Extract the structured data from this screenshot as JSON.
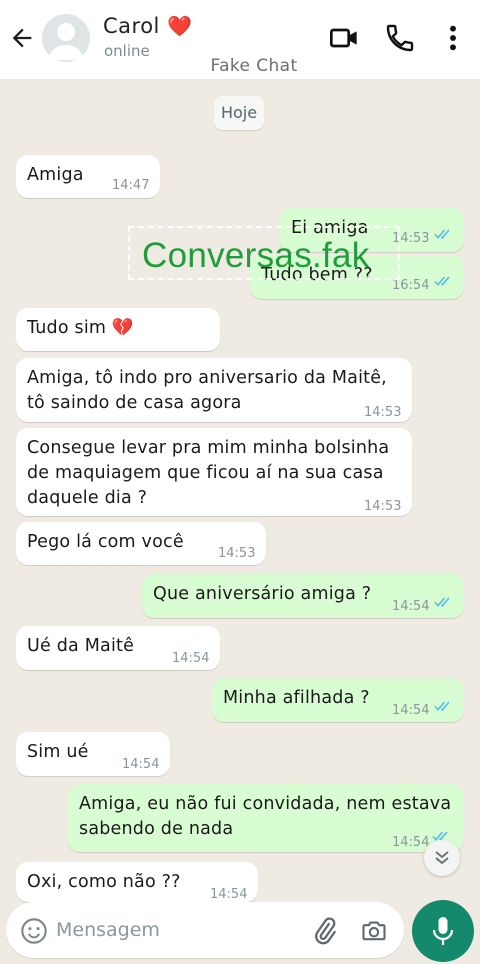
{
  "header": {
    "contact_name": "Carol",
    "contact_emoji": "❤️",
    "status": "online",
    "subtitle": "Fake Chat"
  },
  "chat": {
    "date_chip": "Hoje",
    "messages": [
      {
        "dir": "in",
        "text": "Amiga",
        "time": "14:47"
      },
      {
        "dir": "out",
        "text": "Ei amiga",
        "time": "14:53",
        "read": true
      },
      {
        "dir": "out",
        "text": "Tudo bem ??",
        "time": "16:54",
        "read": true
      },
      {
        "dir": "in",
        "text": "Tudo sim 💔",
        "time": ""
      },
      {
        "dir": "in",
        "text": "Amiga, tô indo pro aniversario da Maitê,\ntô saindo de casa agora",
        "time": "14:53"
      },
      {
        "dir": "in",
        "text": "Consegue levar pra mim minha bolsinha\nde maquiagem que ficou aí na sua casa\ndaquele dia ?",
        "time": "14:53"
      },
      {
        "dir": "in",
        "text": "Pego lá com você",
        "time": "14:53"
      },
      {
        "dir": "out",
        "text": "Que aniversário amiga ?",
        "time": "14:54",
        "read": true
      },
      {
        "dir": "in",
        "text": "Ué da Maitê",
        "time": "14:54"
      },
      {
        "dir": "out",
        "text": "Minha afilhada ?",
        "time": "14:54",
        "read": true
      },
      {
        "dir": "in",
        "text": "Sim ué",
        "time": "14:54"
      },
      {
        "dir": "out",
        "text": "Amiga, eu não fui convidada, nem estava\nsabendo de nada",
        "time": "14:54",
        "read": true
      },
      {
        "dir": "in",
        "text": "Oxi, como não ??",
        "time": "14:54"
      }
    ]
  },
  "watermark": "Conversas.fak",
  "composer": {
    "placeholder": "Mensagem"
  },
  "colors": {
    "chat_bg": "#efeae2",
    "incoming_bubble": "#ffffff",
    "outgoing_bubble": "#d9fdd3",
    "read_ticks": "#53bdeb",
    "mic_button": "#15896b",
    "watermark": "#1e9e3a"
  },
  "icons": {
    "back": "arrow-left-icon",
    "video": "video-camera-icon",
    "call": "phone-icon",
    "menu": "more-vertical-icon",
    "emoji": "smiley-icon",
    "attach": "paperclip-icon",
    "camera": "camera-icon",
    "mic": "microphone-icon",
    "scroll": "double-chevron-down-icon"
  }
}
